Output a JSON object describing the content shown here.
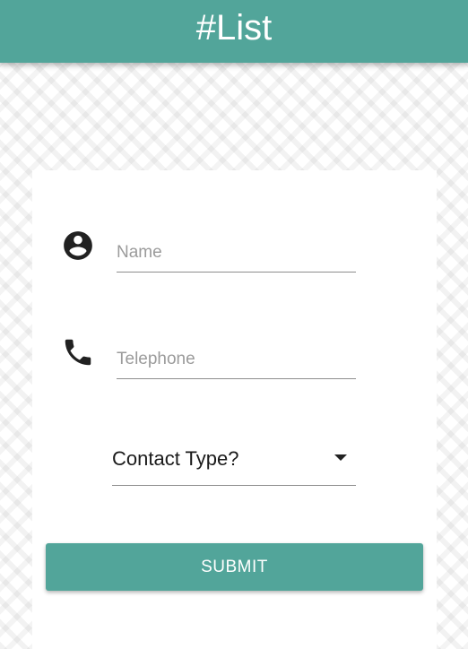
{
  "app_bar": {
    "title": "#List",
    "color": "#52a59a"
  },
  "form": {
    "name_field": {
      "icon": "account-circle-icon",
      "placeholder": "Name",
      "value": ""
    },
    "telephone_field": {
      "icon": "phone-icon",
      "placeholder": "Telephone",
      "value": ""
    },
    "contact_type": {
      "label": "Contact Type?",
      "icon": "caret-down-icon"
    },
    "submit_label": "SUBMIT"
  }
}
